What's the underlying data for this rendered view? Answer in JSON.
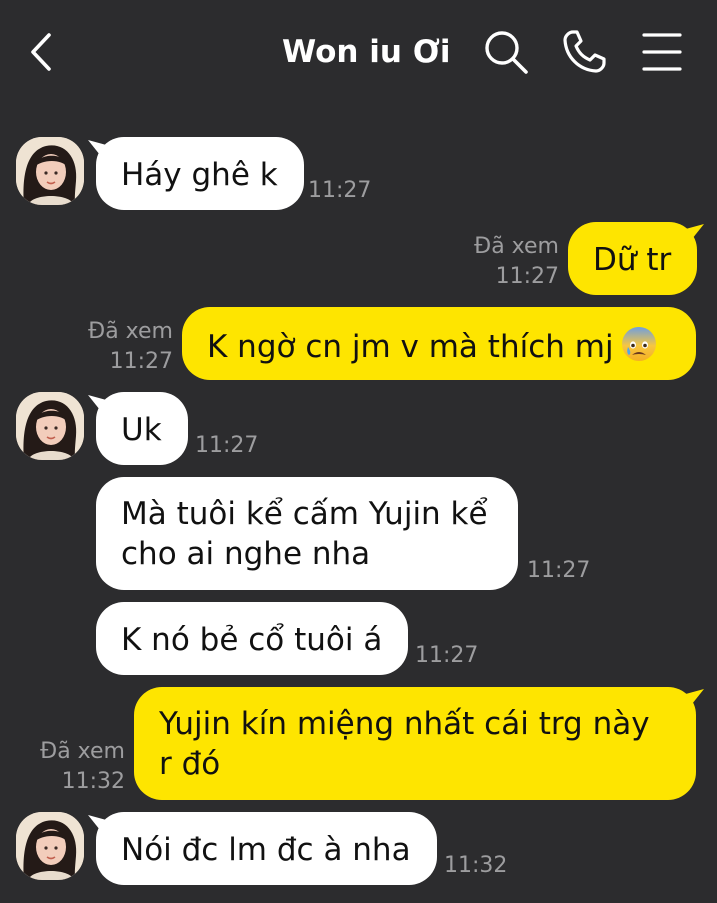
{
  "header": {
    "title": "Won iu Ơi"
  },
  "colors": {
    "background": "#2c2c2e",
    "incoming_bubble": "#ffffff",
    "outgoing_bubble": "#fee500",
    "meta_text": "#9d9d9f"
  },
  "icons": {
    "back": "chevron-left-icon",
    "search": "search-icon",
    "call": "phone-icon",
    "menu": "hamburger-menu-icon",
    "emoji": "anxious-face-with-sweat-emoji"
  },
  "messages": [
    {
      "direction": "in",
      "text": "Háy ghê k",
      "time": "11:27"
    },
    {
      "direction": "out",
      "text": "Dữ tr",
      "read": "Đã xem",
      "time": "11:27"
    },
    {
      "direction": "out",
      "text": "K ngờ cn jm v mà thích mj",
      "read": "Đã xem",
      "time": "11:27"
    },
    {
      "direction": "in",
      "text": "Uk",
      "time": "11:27"
    },
    {
      "direction": "in",
      "text": "Mà tuôi kể cấm Yujin kể cho ai nghe nha",
      "time": "11:27"
    },
    {
      "direction": "in",
      "text": "K nó bẻ cổ tuôi á",
      "time": "11:27"
    },
    {
      "direction": "out",
      "text": "Yujin kín miệng nhất cái trg này r đó",
      "read": "Đã xem",
      "time": "11:32"
    },
    {
      "direction": "in",
      "text": "Nói đc lm đc à nha",
      "time": "11:32"
    }
  ]
}
